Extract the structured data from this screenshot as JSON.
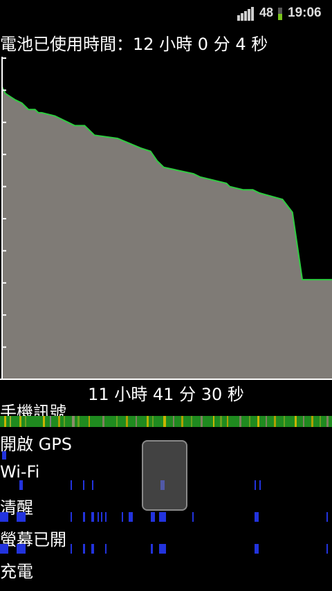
{
  "status_bar": {
    "battery_level": "48",
    "time": "19:06"
  },
  "header": {
    "time_used": "電池已使用時間：12 小時 0 分 4 秒"
  },
  "chart_data": {
    "type": "area",
    "title": "",
    "xlabel": "",
    "ylabel": "",
    "ylim": [
      0,
      100
    ],
    "x": [
      0,
      1,
      4,
      6,
      7,
      8,
      10,
      11,
      12,
      16,
      18,
      20,
      22,
      25,
      27,
      28,
      35,
      42,
      45,
      47,
      49,
      58,
      60,
      68,
      69,
      73,
      76,
      78,
      85,
      88,
      91,
      100
    ],
    "series": [
      {
        "name": "",
        "values": [
          91,
          89,
          87,
          86,
          85,
          84,
          84,
          83,
          83,
          82,
          81,
          80,
          79,
          79,
          77,
          76,
          75,
          72,
          71,
          68,
          66,
          64,
          63,
          61,
          60,
          59,
          59,
          58,
          56,
          52,
          31,
          31
        ]
      }
    ],
    "fill_color": "#7f7b76",
    "line_color": "#2ecc40",
    "grid": false
  },
  "duration": "11 小時 41 分 30 秒",
  "rows": [
    {
      "label": "手機訊號"
    },
    {
      "label": "開啟 GPS"
    },
    {
      "label": "Wi-Fi"
    },
    {
      "label": "清醒"
    },
    {
      "label": "螢幕已開"
    },
    {
      "label": "充電"
    }
  ]
}
